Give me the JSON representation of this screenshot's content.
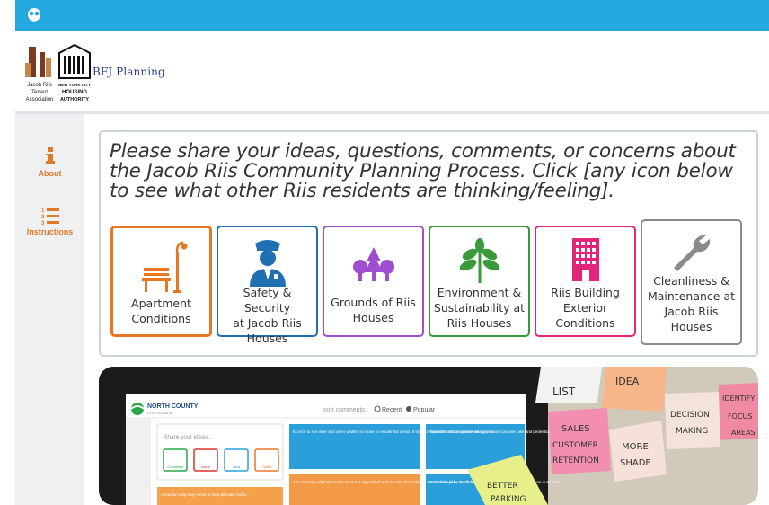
{
  "header": {
    "brand_text": "BFJ Planning",
    "jr_logo_text": [
      "Jacob Riis",
      "Tenant",
      "Association"
    ],
    "nycha_logo_text": [
      "NEW YORK CITY",
      "HOUSING",
      "AUTHORITY"
    ]
  },
  "sidebar": {
    "items": [
      {
        "label": "About",
        "icon": "info-icon"
      },
      {
        "label": "Instructions",
        "icon": "numbered-list-icon"
      }
    ]
  },
  "prompt": {
    "text": "Please share your ideas, questions, comments, or concerns about the Jacob Riis Community Planning Process. Click [any icon below to see what other Riis residents are thinking/feeling]."
  },
  "categories": [
    {
      "lines": [
        "Apartment",
        "Conditions"
      ],
      "color": "#e87722",
      "icon": "park-bench-icon"
    },
    {
      "lines": [
        "Safety & Security",
        "at Jacob Riis",
        "Houses"
      ],
      "color": "#1f6fb2",
      "icon": "police-officer-icon"
    },
    {
      "lines": [
        "Grounds of Riis",
        "Houses"
      ],
      "color": "#a04ed0",
      "icon": "trees-icon"
    },
    {
      "lines": [
        "Environment &",
        "Sustainability at",
        "Riis Houses"
      ],
      "color": "#3a9a3a",
      "icon": "leaf-plant-icon"
    },
    {
      "lines": [
        "Riis Building",
        "Exterior",
        "Conditions"
      ],
      "color": "#e0257a",
      "icon": "building-icon"
    },
    {
      "lines": [
        "Cleanliness &",
        "Maintenance at",
        "Jacob Riis",
        "Houses"
      ],
      "color": "#8a8a8a",
      "icon": "wrench-icon"
    }
  ],
  "promo": {
    "app_brand": "NORTH COUNTY",
    "app_sub": "CITY COUNCIL",
    "sort_label": "sort comments:",
    "sort_recent": "Recent",
    "sort_popular": "Popular",
    "share_placeholder": "Share your ideas...",
    "buttons": [
      "Comment",
      "Issue",
      "Idea",
      "Traffic"
    ],
    "cards": [
      "Its nice to see deer and other wildlife so close to residential areas. It should expanded into the conservation area.",
      "Transform what appears an ugly service provide bike and pedestrian access from & create a nice space to sit.",
      "The crossing adjacent to the school is very faded and so cars don't always see it. It would be much safer if this had a face lift.",
      "Great little park. But kids. Short walking be nice if it were some dust such...",
      "A median strip may serve to help alleviate traffic..."
    ],
    "notes": [
      "LIST",
      "IDEA",
      "IDENTIFY",
      "FOCUS",
      "AREAS",
      "DECISION",
      "MAKING",
      "SALES",
      "CUSTOMER",
      "RETENTION",
      "MORE",
      "SHADE",
      "BETTER",
      "PARKING"
    ]
  }
}
